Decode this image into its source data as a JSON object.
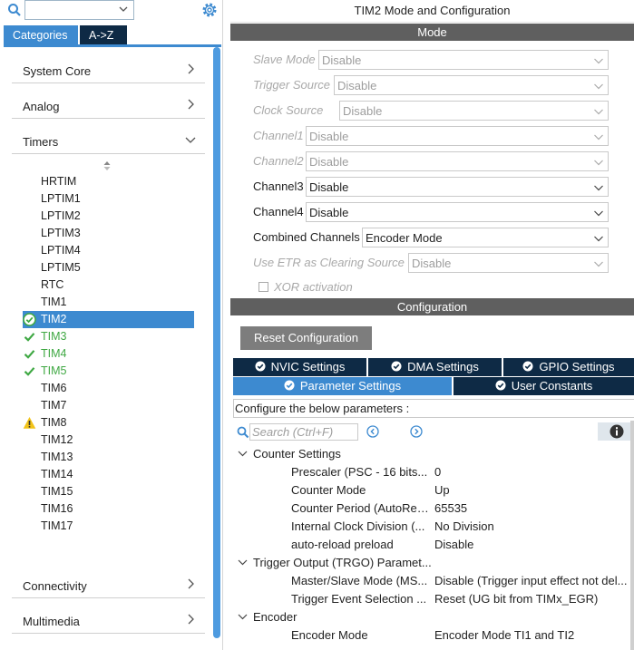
{
  "left": {
    "search_placeholder": "",
    "tabs": [
      "Categories",
      "A->Z"
    ],
    "categories": {
      "system_core": "System Core",
      "analog": "Analog",
      "timers": "Timers",
      "connectivity": "Connectivity",
      "multimedia": "Multimedia"
    },
    "timers": [
      {
        "label": "HRTIM",
        "status": "none"
      },
      {
        "label": "LPTIM1",
        "status": "none"
      },
      {
        "label": "LPTIM2",
        "status": "none"
      },
      {
        "label": "LPTIM3",
        "status": "none"
      },
      {
        "label": "LPTIM4",
        "status": "none"
      },
      {
        "label": "LPTIM5",
        "status": "none"
      },
      {
        "label": "RTC",
        "status": "none"
      },
      {
        "label": "TIM1",
        "status": "none"
      },
      {
        "label": "TIM2",
        "status": "ok-selected"
      },
      {
        "label": "TIM3",
        "status": "ok"
      },
      {
        "label": "TIM4",
        "status": "ok"
      },
      {
        "label": "TIM5",
        "status": "ok"
      },
      {
        "label": "TIM6",
        "status": "none"
      },
      {
        "label": "TIM7",
        "status": "none"
      },
      {
        "label": "TIM8",
        "status": "warning"
      },
      {
        "label": "TIM12",
        "status": "none"
      },
      {
        "label": "TIM13",
        "status": "none"
      },
      {
        "label": "TIM14",
        "status": "none"
      },
      {
        "label": "TIM15",
        "status": "none"
      },
      {
        "label": "TIM16",
        "status": "none"
      },
      {
        "label": "TIM17",
        "status": "none"
      }
    ]
  },
  "right": {
    "title": "TIM2 Mode and Configuration",
    "mode_band": "Mode",
    "mode_rows": [
      {
        "label": "Slave Mode",
        "value": "Disable",
        "disabled": true
      },
      {
        "label": "Trigger Source",
        "value": "Disable",
        "disabled": true
      },
      {
        "label": "Clock Source",
        "value": "Disable",
        "disabled": true
      },
      {
        "label": "Channel1",
        "value": "Disable",
        "disabled": true
      },
      {
        "label": "Channel2",
        "value": "Disable",
        "disabled": true
      },
      {
        "label": "Channel3",
        "value": "Disable",
        "disabled": false
      },
      {
        "label": "Channel4",
        "value": "Disable",
        "disabled": false
      },
      {
        "label": "Combined Channels",
        "value": "Encoder Mode",
        "disabled": false
      },
      {
        "label": "Use ETR as Clearing Source",
        "value": "Disable",
        "disabled": true
      }
    ],
    "xor_label": "XOR activation",
    "config_band": "Configuration",
    "reset_button": "Reset Configuration",
    "config_tabs": {
      "nvic": "NVIC Settings",
      "dma": "DMA Settings",
      "gpio": "GPIO Settings",
      "params": "Parameter Settings",
      "user_constants": "User Constants"
    },
    "param_head": "Configure the below parameters :",
    "param_search_placeholder": "Search (Ctrl+F)",
    "sections": {
      "counter": "Counter Settings",
      "trgo": "Trigger Output (TRGO) Paramet...",
      "encoder": "Encoder"
    },
    "counter_params": [
      {
        "name": "Prescaler (PSC - 16 bits...",
        "value": "0"
      },
      {
        "name": "Counter Mode",
        "value": "Up"
      },
      {
        "name": "Counter Period (AutoRel...",
        "value": "65535"
      },
      {
        "name": "Internal Clock Division (...",
        "value": "No Division"
      },
      {
        "name": "auto-reload preload",
        "value": "Disable"
      }
    ],
    "trgo_params": [
      {
        "name": "Master/Slave Mode (MS...",
        "value": "Disable (Trigger input effect not del..."
      },
      {
        "name": "Trigger Event Selection ...",
        "value": "Reset (UG bit from TIMx_EGR)"
      }
    ],
    "encoder_params": [
      {
        "name": "Encoder Mode",
        "value": "Encoder Mode TI1 and TI2"
      }
    ]
  },
  "colors": {
    "accent": "#3d8ad0",
    "dark_tab": "#0e2a45",
    "band": "#5f5f5f",
    "ok": "#3fa843",
    "warning": "#f2c318"
  }
}
